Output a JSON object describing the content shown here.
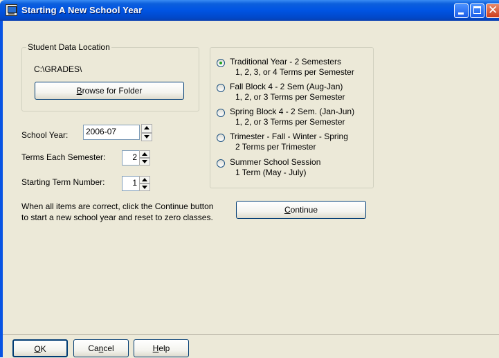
{
  "window": {
    "title": "Starting A New School Year"
  },
  "data_location": {
    "legend": "Student Data Location",
    "path": "C:\\GRADES\\",
    "browse_label": "Browse for Folder",
    "browse_mnemonic": "B"
  },
  "school_year": {
    "label": "School Year:",
    "value": "2006-07"
  },
  "terms_each_semester": {
    "label": "Terms Each Semester:",
    "value": "2"
  },
  "starting_term_number": {
    "label": "Starting Term Number:",
    "value": "1"
  },
  "year_types": [
    {
      "label": "Traditional Year - 2 Semesters",
      "detail": "1, 2, 3, or 4 Terms per Semester",
      "selected": true
    },
    {
      "label": "Fall Block 4 - 2 Sem (Aug-Jan)",
      "detail": "1, 2, or 3 Terms per Semester",
      "selected": false
    },
    {
      "label": "Spring Block 4 - 2 Sem. (Jan-Jun)",
      "detail": "1, 2, or 3 Terms per Semester",
      "selected": false
    },
    {
      "label": "Trimester - Fall - Winter - Spring",
      "detail": "2 Terms per Trimester",
      "selected": false
    },
    {
      "label": "Summer School Session",
      "detail": "1 Term (May - July)",
      "selected": false
    }
  ],
  "instructions": {
    "line1": "When all items are correct, click the Continue button",
    "line2": "to start a new school year and reset to zero classes."
  },
  "continue_button": {
    "label": "Continue"
  },
  "footer": {
    "ok_label": "OK",
    "cancel_label": "Cancel",
    "help_label": "Help"
  }
}
